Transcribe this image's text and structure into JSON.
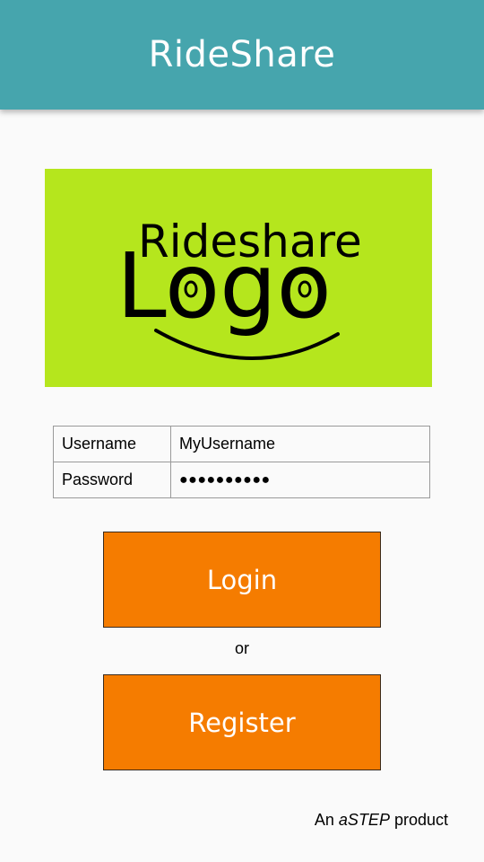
{
  "app_bar": {
    "title": "RideShare"
  },
  "logo": {
    "line1": "Rideshare",
    "line2": "Logo",
    "background_color": "#b5e61d"
  },
  "form": {
    "username_label": "Username",
    "username_value": "MyUsername",
    "password_label": "Password",
    "password_value": "●●●●●●●●●●"
  },
  "buttons": {
    "login_label": "Login",
    "or_text": "or",
    "register_label": "Register",
    "accent_color": "#f57c00"
  },
  "footer": {
    "prefix": "An ",
    "brand": "aSTEP",
    "suffix": " product"
  },
  "colors": {
    "app_bar": "#46a5ad",
    "background": "#fafafa"
  }
}
